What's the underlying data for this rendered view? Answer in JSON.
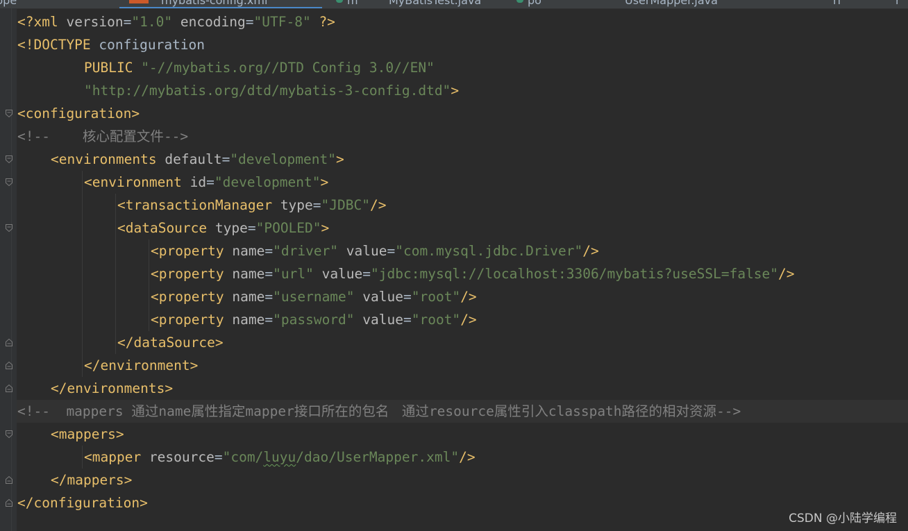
{
  "editor": {
    "tab_fragments": [
      "ppe",
      "mybatis-config.xml",
      "m",
      "MyBatisTest.java",
      "po",
      "UserMapper.java",
      "rl",
      "r"
    ],
    "lines": [
      {
        "indent": 0,
        "fold": null,
        "tokens": [
          {
            "t": "<?xml ",
            "c": "decl"
          },
          {
            "t": "version",
            "c": "attr"
          },
          {
            "t": "=",
            "c": "text"
          },
          {
            "t": "\"1.0\"",
            "c": "val"
          },
          {
            "t": " ",
            "c": "text"
          },
          {
            "t": "encoding",
            "c": "attr"
          },
          {
            "t": "=",
            "c": "text"
          },
          {
            "t": "\"UTF-8\"",
            "c": "val"
          },
          {
            "t": " ?>",
            "c": "decl"
          }
        ]
      },
      {
        "indent": 0,
        "fold": null,
        "tokens": [
          {
            "t": "<!DOCTYPE ",
            "c": "decl"
          },
          {
            "t": "configuration",
            "c": "text"
          }
        ]
      },
      {
        "indent": 8,
        "fold": null,
        "tokens": [
          {
            "t": "PUBLIC ",
            "c": "decl"
          },
          {
            "t": "\"-//mybatis.org//DTD Config 3.0//EN\"",
            "c": "val"
          }
        ]
      },
      {
        "indent": 8,
        "fold": null,
        "tokens": [
          {
            "t": "\"http://mybatis.org/dtd/mybatis-3-config.dtd\"",
            "c": "val"
          },
          {
            "t": ">",
            "c": "decl"
          }
        ]
      },
      {
        "indent": 0,
        "fold": "open",
        "tokens": [
          {
            "t": "<configuration>",
            "c": "tag"
          }
        ]
      },
      {
        "indent": 0,
        "fold": null,
        "tokens": [
          {
            "t": "<!--    ",
            "c": "comment"
          },
          {
            "t": "核心配置文件",
            "c": "comment",
            "cjk": true
          },
          {
            "t": "-->",
            "c": "comment"
          }
        ]
      },
      {
        "indent": 4,
        "fold": "open",
        "tokens": [
          {
            "t": "<environments ",
            "c": "tag"
          },
          {
            "t": "default",
            "c": "attr"
          },
          {
            "t": "=",
            "c": "text"
          },
          {
            "t": "\"development\"",
            "c": "val"
          },
          {
            "t": ">",
            "c": "tag"
          }
        ]
      },
      {
        "indent": 8,
        "fold": "open",
        "tokens": [
          {
            "t": "<environment ",
            "c": "tag"
          },
          {
            "t": "id",
            "c": "attr"
          },
          {
            "t": "=",
            "c": "text"
          },
          {
            "t": "\"development\"",
            "c": "val"
          },
          {
            "t": ">",
            "c": "tag"
          }
        ]
      },
      {
        "indent": 12,
        "fold": null,
        "tokens": [
          {
            "t": "<transactionManager ",
            "c": "tag"
          },
          {
            "t": "type",
            "c": "attr"
          },
          {
            "t": "=",
            "c": "text"
          },
          {
            "t": "\"JDBC\"",
            "c": "val"
          },
          {
            "t": "/>",
            "c": "tag"
          }
        ]
      },
      {
        "indent": 12,
        "fold": "open",
        "tokens": [
          {
            "t": "<dataSource ",
            "c": "tag"
          },
          {
            "t": "type",
            "c": "attr"
          },
          {
            "t": "=",
            "c": "text"
          },
          {
            "t": "\"POOLED\"",
            "c": "val"
          },
          {
            "t": ">",
            "c": "tag"
          }
        ]
      },
      {
        "indent": 16,
        "fold": null,
        "tokens": [
          {
            "t": "<property ",
            "c": "tag"
          },
          {
            "t": "name",
            "c": "attr"
          },
          {
            "t": "=",
            "c": "text"
          },
          {
            "t": "\"driver\"",
            "c": "val"
          },
          {
            "t": " ",
            "c": "text"
          },
          {
            "t": "value",
            "c": "attr"
          },
          {
            "t": "=",
            "c": "text"
          },
          {
            "t": "\"com.mysql.jdbc.Driver\"",
            "c": "val"
          },
          {
            "t": "/>",
            "c": "tag"
          }
        ]
      },
      {
        "indent": 16,
        "fold": null,
        "tokens": [
          {
            "t": "<property ",
            "c": "tag"
          },
          {
            "t": "name",
            "c": "attr"
          },
          {
            "t": "=",
            "c": "text"
          },
          {
            "t": "\"url\"",
            "c": "val"
          },
          {
            "t": " ",
            "c": "text"
          },
          {
            "t": "value",
            "c": "attr"
          },
          {
            "t": "=",
            "c": "text"
          },
          {
            "t": "\"jdbc:mysql://localhost:3306/mybatis?useSSL=false\"",
            "c": "val"
          },
          {
            "t": "/>",
            "c": "tag"
          }
        ]
      },
      {
        "indent": 16,
        "fold": null,
        "tokens": [
          {
            "t": "<property ",
            "c": "tag"
          },
          {
            "t": "name",
            "c": "attr"
          },
          {
            "t": "=",
            "c": "text"
          },
          {
            "t": "\"username\"",
            "c": "val"
          },
          {
            "t": " ",
            "c": "text"
          },
          {
            "t": "value",
            "c": "attr"
          },
          {
            "t": "=",
            "c": "text"
          },
          {
            "t": "\"root\"",
            "c": "val"
          },
          {
            "t": "/>",
            "c": "tag"
          }
        ]
      },
      {
        "indent": 16,
        "fold": null,
        "tokens": [
          {
            "t": "<property ",
            "c": "tag"
          },
          {
            "t": "name",
            "c": "attr"
          },
          {
            "t": "=",
            "c": "text"
          },
          {
            "t": "\"password\"",
            "c": "val"
          },
          {
            "t": " ",
            "c": "text"
          },
          {
            "t": "value",
            "c": "attr"
          },
          {
            "t": "=",
            "c": "text"
          },
          {
            "t": "\"root\"",
            "c": "val"
          },
          {
            "t": "/>",
            "c": "tag"
          }
        ]
      },
      {
        "indent": 12,
        "fold": "close",
        "tokens": [
          {
            "t": "</dataSource>",
            "c": "tag"
          }
        ]
      },
      {
        "indent": 8,
        "fold": "close",
        "tokens": [
          {
            "t": "</environment>",
            "c": "tag"
          }
        ]
      },
      {
        "indent": 4,
        "fold": "close",
        "tokens": [
          {
            "t": "</environments>",
            "c": "tag"
          }
        ]
      },
      {
        "indent": 0,
        "fold": null,
        "tokens": [
          {
            "t": "<!--  mappers ",
            "c": "comment"
          },
          {
            "t": "通过",
            "c": "comment",
            "cjk": true
          },
          {
            "t": "name",
            "c": "comment"
          },
          {
            "t": "属性指定",
            "c": "comment",
            "cjk": true
          },
          {
            "t": "mapper",
            "c": "comment"
          },
          {
            "t": "接口所在的包名   通过",
            "c": "comment",
            "cjk": true
          },
          {
            "t": "resource",
            "c": "comment"
          },
          {
            "t": "属性引入",
            "c": "comment",
            "cjk": true
          },
          {
            "t": "classpath",
            "c": "comment"
          },
          {
            "t": "路径的相对资源",
            "c": "comment",
            "cjk": true
          },
          {
            "t": "-->",
            "c": "comment"
          }
        ]
      },
      {
        "indent": 4,
        "fold": "open",
        "tokens": [
          {
            "t": "<mappers>",
            "c": "tag"
          }
        ]
      },
      {
        "indent": 8,
        "fold": null,
        "tokens": [
          {
            "t": "<mapper ",
            "c": "tag"
          },
          {
            "t": "resource",
            "c": "attr"
          },
          {
            "t": "=",
            "c": "text"
          },
          {
            "t": "\"com/",
            "c": "val"
          },
          {
            "t": "luyu",
            "c": "val",
            "squiggle": true
          },
          {
            "t": "/dao/UserMapper.xml\"",
            "c": "val"
          },
          {
            "t": "/>",
            "c": "tag"
          }
        ]
      },
      {
        "indent": 4,
        "fold": "close",
        "tokens": [
          {
            "t": "</mappers>",
            "c": "tag"
          }
        ]
      },
      {
        "indent": 0,
        "fold": "close",
        "tokens": [
          {
            "t": "</configuration>",
            "c": "tag"
          }
        ]
      }
    ]
  },
  "watermark": "CSDN @小陆学编程"
}
